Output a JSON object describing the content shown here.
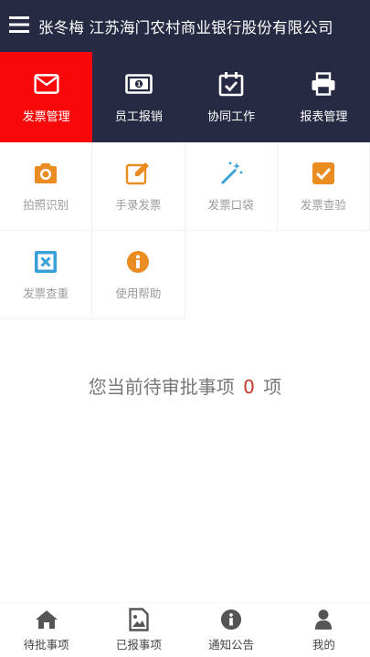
{
  "header": {
    "user_name": "张冬梅",
    "org_name": "江苏海门农村商业银行股份有限公司",
    "menu_icon": "hamburger-icon"
  },
  "topnav": {
    "items": [
      {
        "label": "发票管理",
        "icon": "envelope-icon",
        "active": true
      },
      {
        "label": "员工报销",
        "icon": "banknote-icon",
        "active": false
      },
      {
        "label": "协同工作",
        "icon": "calendar-check-icon",
        "active": false
      },
      {
        "label": "报表管理",
        "icon": "printer-icon",
        "active": false
      }
    ],
    "active_color": "#f80808",
    "bg_color": "#262a42"
  },
  "grid": {
    "items": [
      {
        "label": "拍照识别",
        "icon": "camera-icon",
        "color": "#e98d22"
      },
      {
        "label": "手录发票",
        "icon": "pencil-edit-icon",
        "color": "#e98d22"
      },
      {
        "label": "发票口袋",
        "icon": "magic-wand-icon",
        "color": "#3aa0d8"
      },
      {
        "label": "发票查验",
        "icon": "checkbox-icon",
        "color": "#e98d22"
      },
      {
        "label": "发票查重",
        "icon": "close-square-icon",
        "color": "#3aa0d8"
      },
      {
        "label": "使用帮助",
        "icon": "info-circle-icon",
        "color": "#e98d22"
      }
    ]
  },
  "status": {
    "prefix": "您当前待审批事项",
    "count": "0",
    "suffix": "项"
  },
  "bottomnav": {
    "items": [
      {
        "label": "待批事项",
        "icon": "home-icon"
      },
      {
        "label": "已报事项",
        "icon": "image-file-icon"
      },
      {
        "label": "通知公告",
        "icon": "info-circle-icon"
      },
      {
        "label": "我的",
        "icon": "user-icon"
      }
    ]
  }
}
